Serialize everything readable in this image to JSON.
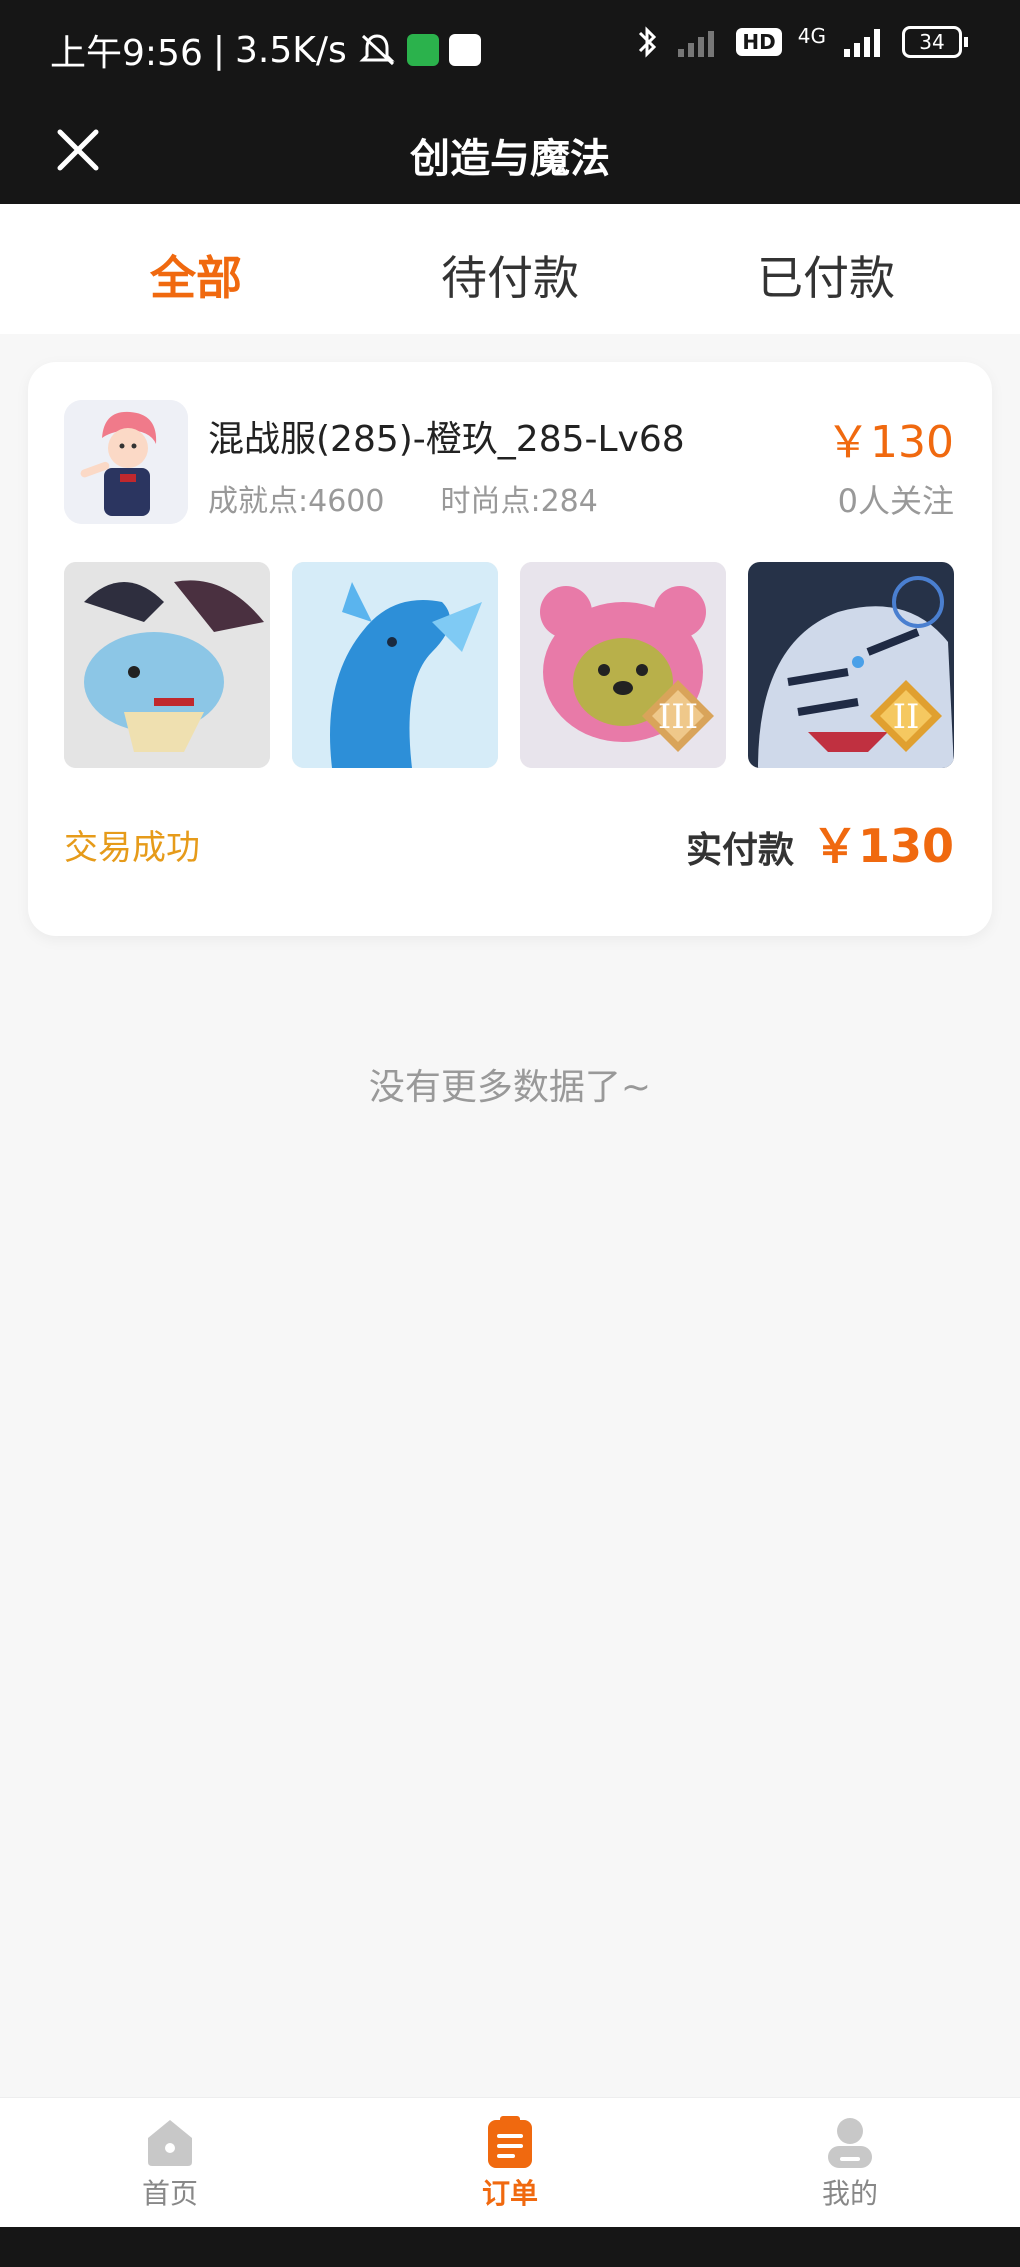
{
  "status_bar": {
    "time": "上午9:56",
    "speed": "3.5K/s",
    "hd": "HD",
    "network": "4G",
    "battery": "34"
  },
  "header": {
    "title": "创造与魔法"
  },
  "tabs": [
    {
      "label": "全部",
      "active": true
    },
    {
      "label": "待付款",
      "active": false
    },
    {
      "label": "已付款",
      "active": false
    }
  ],
  "order": {
    "server": "混战服(285)-橙玖_285-Lv68",
    "achievement": "成就点:4600",
    "fashion": "时尚点:284",
    "price": "￥130",
    "followers": "0人关注",
    "items": [
      {
        "icon": "dragon-icon",
        "badge": ""
      },
      {
        "icon": "sea-horse-icon",
        "badge": ""
      },
      {
        "icon": "bear-icon",
        "badge": "III"
      },
      {
        "icon": "tiger-icon",
        "badge": "II"
      }
    ],
    "status": "交易成功",
    "paid_label": "实付款",
    "paid_amount": "￥130"
  },
  "list_end": "没有更多数据了~",
  "bottom_nav": [
    {
      "label": "首页",
      "icon": "home-icon",
      "active": false
    },
    {
      "label": "订单",
      "icon": "order-icon",
      "active": true
    },
    {
      "label": "我的",
      "icon": "profile-icon",
      "active": false
    }
  ],
  "colors": {
    "accent": "#f0690f",
    "success": "#e69b1a"
  }
}
